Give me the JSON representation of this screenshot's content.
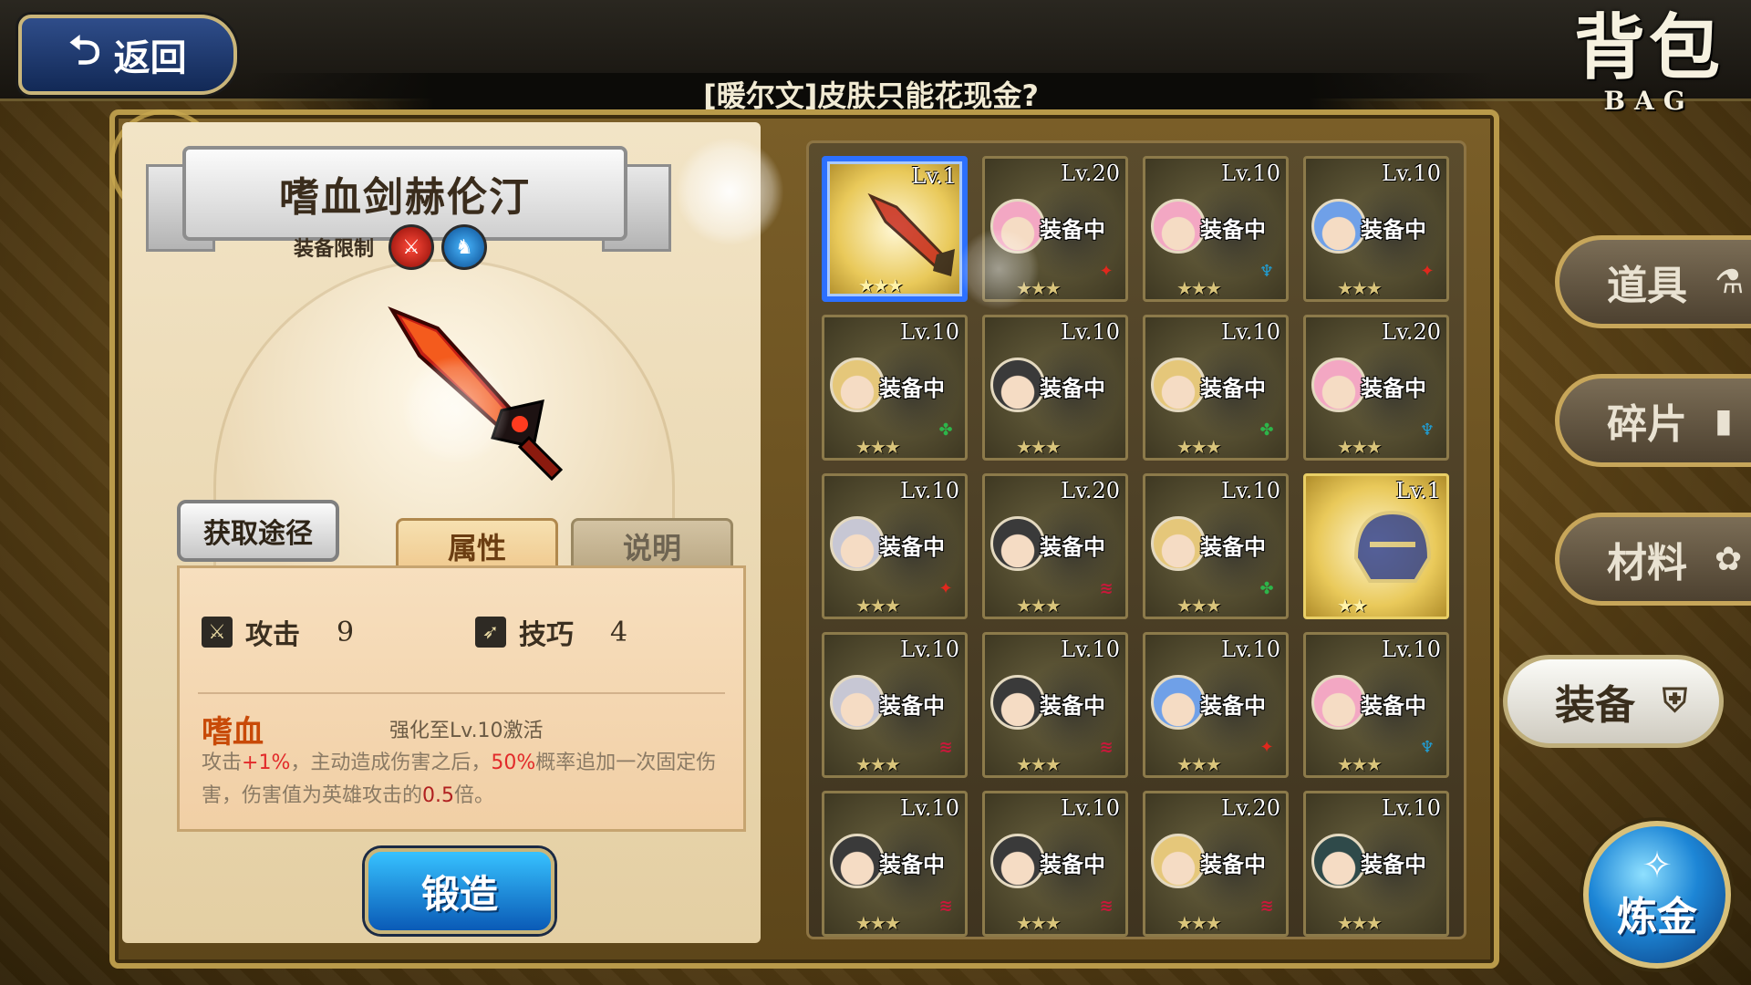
{
  "header": {
    "back_label": "返回",
    "title": "[暖尔文]皮肤只能花现金?",
    "bag_title": "背包",
    "bag_subtitle": "BAG"
  },
  "item_detail": {
    "name": "嗜血剑赫伦汀",
    "limit_label": "装备限制",
    "limit_classes": [
      "sword-class-icon",
      "horse-class-icon"
    ],
    "source_button": "获取途径",
    "tabs": {
      "attributes": "属性",
      "description": "说明"
    },
    "stats": [
      {
        "label": "攻击",
        "value": "9",
        "icon": "sword-stat-icon"
      },
      {
        "label": "技巧",
        "value": "4",
        "icon": "bow-stat-icon"
      }
    ],
    "skill": {
      "name": "嗜血",
      "unlock": "强化至Lv.10激活",
      "desc_part1": "攻击",
      "desc_hl1": "+1%",
      "desc_part2": "，主动造成伤害之后，",
      "desc_hl2": "50%",
      "desc_part3": "概率追加一次固定伤害，伤害值为英雄攻击的",
      "desc_hl3": "0.5",
      "desc_part4": "倍。"
    },
    "forge_button": "锻造"
  },
  "equipped_label": "装备中",
  "grid": [
    {
      "level": "Lv.1",
      "type": "sword",
      "selected": true,
      "gold": true,
      "stars": "★★★"
    },
    {
      "level": "Lv.20",
      "avatar": "#f3a7c3",
      "cls": "red-class",
      "stars": "★★★"
    },
    {
      "level": "Lv.10",
      "avatar": "#f3a7c3",
      "cls": "blue-class",
      "stars": "★★★"
    },
    {
      "level": "Lv.10",
      "avatar": "#6fa0e8",
      "cls": "red-class",
      "stars": "★★★"
    },
    {
      "level": "Lv.10",
      "avatar": "#e5c77a",
      "cls": "green-class",
      "stars": "★★★"
    },
    {
      "level": "Lv.10",
      "avatar": "#3a3a3a",
      "cls": "none",
      "stars": "★★★"
    },
    {
      "level": "Lv.10",
      "avatar": "#e5c77a",
      "cls": "green-class",
      "stars": "★★★"
    },
    {
      "level": "Lv.20",
      "avatar": "#f3a7c3",
      "cls": "blue-class",
      "stars": "★★★"
    },
    {
      "level": "Lv.10",
      "avatar": "#c7c7d4",
      "cls": "red-class",
      "stars": "★★★"
    },
    {
      "level": "Lv.20",
      "avatar": "#3a3a3a",
      "cls": "crimson-class",
      "stars": "★★★"
    },
    {
      "level": "Lv.10",
      "avatar": "#e5c77a",
      "cls": "green-class",
      "stars": "★★★"
    },
    {
      "level": "Lv.1",
      "type": "helmet",
      "gold": true,
      "stars": "★★"
    },
    {
      "level": "Lv.10",
      "avatar": "#c7c7d4",
      "cls": "crimson-class",
      "stars": "★★★"
    },
    {
      "level": "Lv.10",
      "avatar": "#3a3a3a",
      "cls": "crimson-class",
      "stars": "★★★"
    },
    {
      "level": "Lv.10",
      "avatar": "#6fa0e8",
      "cls": "red-class",
      "stars": "★★★"
    },
    {
      "level": "Lv.10",
      "avatar": "#f3a7c3",
      "cls": "blue-class",
      "stars": "★★★"
    },
    {
      "level": "Lv.10",
      "avatar": "#3a3a3a",
      "cls": "crimson-class",
      "stars": "★★★"
    },
    {
      "level": "Lv.10",
      "avatar": "#3a3a3a",
      "cls": "crimson-class",
      "stars": "★★★"
    },
    {
      "level": "Lv.20",
      "avatar": "#e5c77a",
      "cls": "crimson-class",
      "stars": "★★★"
    },
    {
      "level": "Lv.10",
      "avatar": "#2f4a4a",
      "cls": "none",
      "stars": "★★★"
    }
  ],
  "side_tabs": [
    {
      "label": "道具",
      "icon": "potion-icon"
    },
    {
      "label": "碎片",
      "icon": "shard-icon"
    },
    {
      "label": "材料",
      "icon": "flower-icon"
    },
    {
      "label": "装备",
      "icon": "armor-icon",
      "active": true
    }
  ],
  "alchemy": {
    "label": "炼金"
  },
  "colors": {
    "selected_border": "#2c70ff",
    "skill_name": "#c84a08",
    "highlight": "#e22a2a",
    "forge": "#0a5ab6"
  }
}
